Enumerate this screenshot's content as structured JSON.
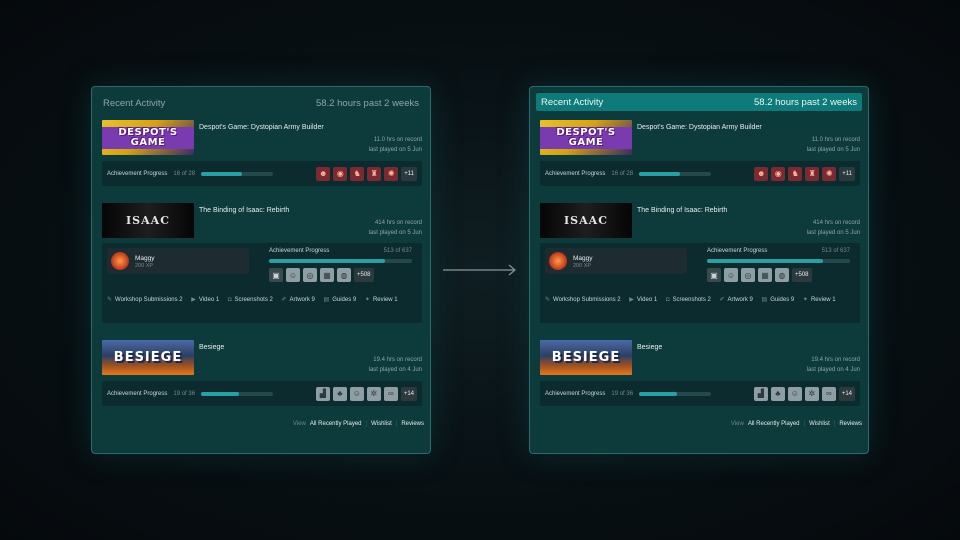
{
  "left": {
    "header": {
      "title": "Recent Activity",
      "hours": "58.2 hours past 2 weeks"
    },
    "games": [
      {
        "capsule_text": "DESPOT'S GAME",
        "name": "Despot's Game: Dystopian Army Builder",
        "hours": "11.0 hrs on record",
        "last_played": "last played on 5 Jun",
        "ach_label": "Achievement Progress",
        "ach_count": "16 of 28",
        "ach_progress": 0.57,
        "ach_icons": [
          "skull-icon",
          "crab-icon",
          "figure-icon",
          "arena-icon",
          "demon-icon"
        ],
        "ach_more": "+11"
      },
      {
        "capsule_text": "ISAAC",
        "name": "The Binding of Isaac: Rebirth",
        "hours": "414 hrs on record",
        "last_played": "last played on 5 Jun",
        "character": {
          "name": "Maggy",
          "xp": "200 XP"
        },
        "ach_label": "Achievement Progress",
        "ach_count": "513 of 637",
        "ach_progress": 0.81,
        "ach_icons": [
          "item-icon",
          "face-icon",
          "eye-icon",
          "grid-icon",
          "coin-icon"
        ],
        "ach_more": "+508",
        "stats": [
          {
            "label": "Workshop Submissions 2"
          },
          {
            "label": "Video 1"
          },
          {
            "label": "Screenshots 2"
          },
          {
            "label": "Artwork 9"
          },
          {
            "label": "Guides 9"
          },
          {
            "label": "Review 1"
          }
        ]
      },
      {
        "capsule_text": "BESIEGE",
        "name": "Besiege",
        "hours": "19.4 hrs on record",
        "last_played": "last played on 4 Jun",
        "ach_label": "Achievement Progress",
        "ach_count": "19 of 36",
        "ach_progress": 0.53,
        "ach_icons": [
          "stairs-icon",
          "tree-icon",
          "face-icon",
          "snowflake-icon",
          "infinity-icon"
        ],
        "ach_more": "+14"
      }
    ],
    "footer": {
      "view": "View",
      "links": [
        "All Recently Played",
        "Wishlist",
        "Reviews"
      ]
    }
  },
  "right": {
    "header": {
      "title": "Recent Activity",
      "hours": "58.2 hours past 2 weeks"
    },
    "games": [
      {
        "capsule_text": "DESPOT'S GAME",
        "name": "Despot's Game: Dystopian Army Builder",
        "hours": "11.0 hrs on record",
        "last_played": "last played on 5 Jun",
        "ach_label": "Achievement Progress",
        "ach_count": "16 of 28",
        "ach_progress": 0.57,
        "ach_more": "+11"
      },
      {
        "capsule_text": "ISAAC",
        "name": "The Binding of Isaac: Rebirth",
        "hours": "414 hrs on record",
        "last_played": "last played on 5 Jun",
        "character": {
          "name": "Maggy",
          "xp": "200 XP"
        },
        "ach_label": "Achievement Progress",
        "ach_count": "513 of 637",
        "ach_progress": 0.81,
        "ach_more": "+508",
        "stats": [
          {
            "label": "Workshop Submissions 2"
          },
          {
            "label": "Video 1"
          },
          {
            "label": "Screenshots 2"
          },
          {
            "label": "Artwork 9"
          },
          {
            "label": "Guides 9"
          },
          {
            "label": "Review 1"
          }
        ]
      },
      {
        "capsule_text": "BESIEGE",
        "name": "Besiege",
        "hours": "19.4 hrs on record",
        "last_played": "last played on 4 Jun",
        "ach_label": "Achievement Progress",
        "ach_count": "19 of 36",
        "ach_progress": 0.53,
        "ach_more": "+14"
      }
    ],
    "footer": {
      "view": "View",
      "links": [
        "All Recently Played",
        "Wishlist",
        "Reviews"
      ]
    }
  },
  "colors": {
    "panel": "#0d3a3a",
    "accent": "#0f7a7a",
    "progress_fill": "#2aa0a6"
  }
}
